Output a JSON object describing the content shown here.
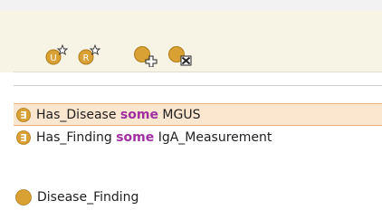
{
  "toolbar": {
    "buttons": [
      {
        "name": "add-union-icon",
        "label": "U"
      },
      {
        "name": "add-restriction-icon",
        "label": "R"
      },
      {
        "name": "add-class-icon",
        "label": ""
      },
      {
        "name": "delete-class-icon",
        "label": ""
      }
    ]
  },
  "restrictions": [
    {
      "quantifier": "∃",
      "property": "Has_Disease",
      "keyword": "some",
      "filler": "MGUS",
      "selected": true
    },
    {
      "quantifier": "∃",
      "property": "Has_Finding",
      "keyword": "some",
      "filler": "IgA_Measurement",
      "selected": false
    }
  ],
  "superclass": {
    "label": "Disease_Finding"
  },
  "colors": {
    "icon_orange": "#d9a034",
    "keyword": "#a12fa1",
    "selection_bg": "#fbe6cf",
    "selection_border": "#e9b27a"
  }
}
